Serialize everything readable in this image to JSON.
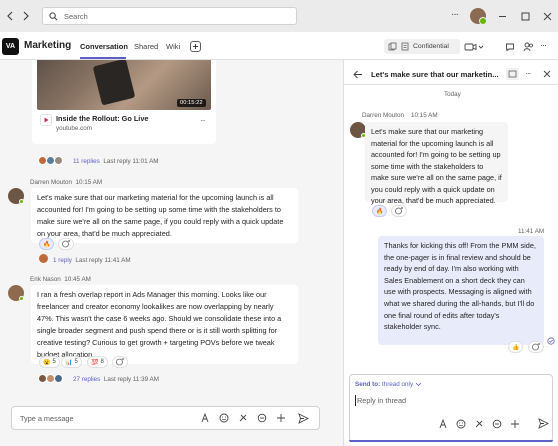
{
  "titlebar": {
    "search_placeholder": "Search",
    "more": "···",
    "window_controls": [
      "minimize-icon",
      "maximize-icon",
      "close-icon"
    ]
  },
  "channel": {
    "team_logo": "VA",
    "title": "Marketing",
    "tabs": [
      {
        "label": "Conversation",
        "active": true
      },
      {
        "label": "Shared",
        "active": false
      },
      {
        "label": "Wiki",
        "active": false
      }
    ],
    "sensitivity": "Confidential"
  },
  "conversation": {
    "video": {
      "duration": "00:15:22",
      "title": "Inside the Rollout: Go Live",
      "source": "youtube.com",
      "replies": "11 replies",
      "last_reply": "Last reply 11:01 AM"
    },
    "messages": [
      {
        "author": "Darren Mouton",
        "time": "10:15 AM",
        "text": "Let's make sure that our marketing material for the upcoming launch is all accounted for! I'm going to be setting up some time with the stakeholders to make sure we're all on the same page, if you could reply with a quick update on your area, that'd be much appreciated.",
        "replies": "1 reply",
        "last_reply": "Last reply 11:41 AM"
      },
      {
        "author": "Erik Nason",
        "time": "10:45 AM",
        "text": "I ran a fresh overlap report in Ads Manager this morning. Looks like our freelancer and creator economy lookalikes are now overlapping by nearly 47%. This wasn't the case 6 weeks ago. Should we consolidate these into a single broader segment and push spend there or is it still worth splitting for creative testing? Curious to get growth + targeting POVs before we tweak budget allocation.",
        "reactions": [
          {
            "emoji": "😮",
            "count": "5"
          },
          {
            "emoji": "📊",
            "count": "5"
          },
          {
            "emoji": "💯",
            "count": "8"
          }
        ],
        "replies": "27 replies",
        "last_reply": "Last reply 11:39 AM"
      }
    ],
    "composer_placeholder": "Type a message"
  },
  "thread": {
    "title": "Let's make sure that our marketin...",
    "day_label": "Today",
    "root": {
      "author": "Darren Mouton",
      "time": "10:15 AM",
      "text": "Let's make sure that our marketing material for the upcoming launch is all accounted for! I'm going to be setting up some time with the stakeholders to make sure we're all on the same page, if you could reply with a quick update on your area, that'd be much appreciated."
    },
    "reply": {
      "time": "11:41 AM",
      "text": "Thanks for kicking this off! From the PMM side, the one-pager is in final review and should be ready by end of day. I'm also working with Sales Enablement on a short deck they can use with prospects. Messaging is aligned with what we shared during the all-hands, but I'll do one final round of edits after today's stakeholder sync."
    },
    "send_to_label": "Send to:",
    "send_to_value": "thread only",
    "reply_placeholder": "Reply in thread"
  },
  "colors": {
    "accent": "#5b5fc7",
    "bubble_mine": "#e8ebfa",
    "presence": "#6bb700"
  }
}
